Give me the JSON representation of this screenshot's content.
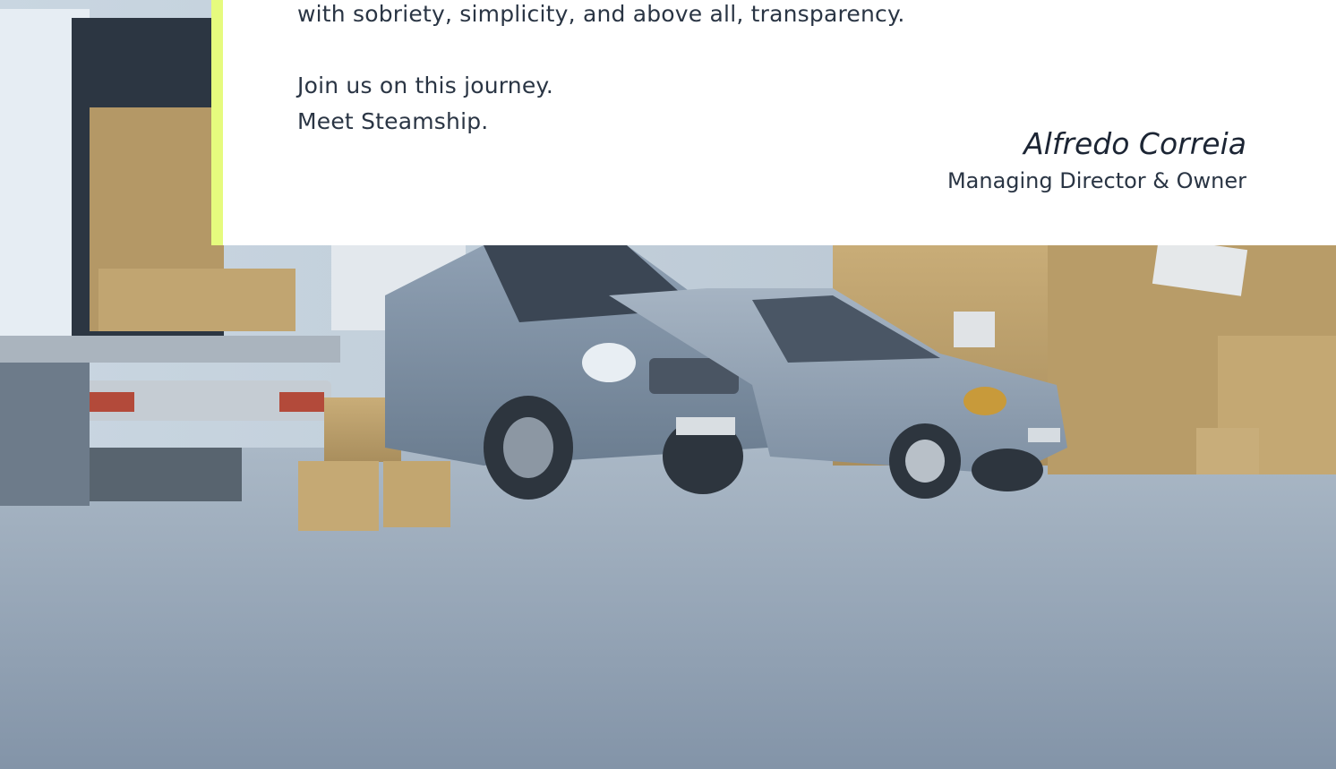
{
  "quote": {
    "line_transparency": "with sobriety, simplicity, and above all, transparency.",
    "line_join": "Join us on this journey.",
    "line_meet": "Meet Steamship.",
    "author_name": "Alfredo Correia",
    "author_role": "Managing Director & Owner"
  },
  "colors": {
    "accent": "#e6fb7e",
    "card_background": "#ffffff",
    "text": "#2a3544"
  },
  "hero_image": {
    "icon": "logistics-vehicles-photo"
  }
}
